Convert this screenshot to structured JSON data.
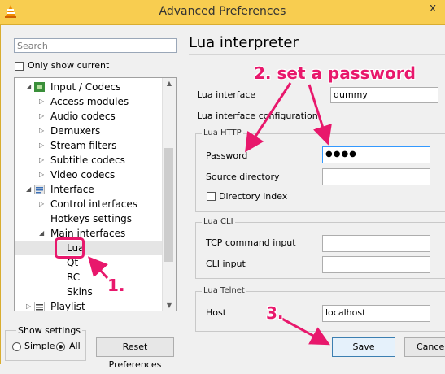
{
  "window": {
    "title": "Advanced Preferences",
    "close_glyph": "x"
  },
  "search": {
    "placeholder": "Search"
  },
  "only_show_current": "Only show current",
  "tree": {
    "items": [
      {
        "label": "Input / Codecs"
      },
      {
        "label": "Access modules"
      },
      {
        "label": "Audio codecs"
      },
      {
        "label": "Demuxers"
      },
      {
        "label": "Stream filters"
      },
      {
        "label": "Subtitle codecs"
      },
      {
        "label": "Video codecs"
      },
      {
        "label": "Interface"
      },
      {
        "label": "Control interfaces"
      },
      {
        "label": "Hotkeys settings"
      },
      {
        "label": "Main interfaces"
      },
      {
        "label": "Lua"
      },
      {
        "label": "Qt"
      },
      {
        "label": "RC"
      },
      {
        "label": "Skins"
      },
      {
        "label": "Playlist"
      }
    ]
  },
  "show_settings": {
    "title": "Show settings",
    "simple": "Simple",
    "all": "All",
    "selected": "All"
  },
  "buttons": {
    "reset": "Reset Preferences",
    "save": "Save",
    "cancel": "Cancel"
  },
  "panel": {
    "heading": "Lua interpreter",
    "lua_interface_label": "Lua interface",
    "lua_interface_value": "dummy",
    "lua_interface_config_label": "Lua interface configuration",
    "lua_http": {
      "title": "Lua HTTP",
      "password_label": "Password",
      "password_value": "●●●●",
      "source_dir_label": "Source directory",
      "directory_index_label": "Directory index"
    },
    "lua_cli": {
      "title": "Lua CLI",
      "tcp_label": "TCP command input",
      "cli_label": "CLI input"
    },
    "lua_telnet": {
      "title": "Lua Telnet",
      "host_label": "Host",
      "host_value": "localhost"
    }
  },
  "annotations": {
    "step1": "1.",
    "step2": "2. set a password",
    "step3": "3.",
    "color": "#e8186c"
  }
}
